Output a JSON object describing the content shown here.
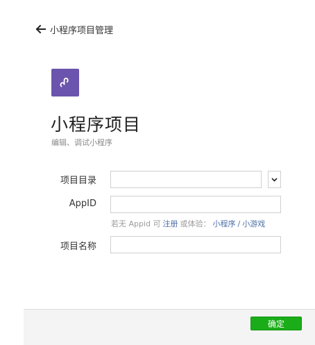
{
  "nav": {
    "back_label": "小程序项目管理"
  },
  "header": {
    "logo_icon": "mini-program-logo-icon",
    "logo_color": "#6b54ad",
    "title": "小程序项目",
    "subtitle": "编辑、调试小程序"
  },
  "form": {
    "directory": {
      "label": "项目目录",
      "value": ""
    },
    "appid": {
      "label": "AppID",
      "value": ""
    },
    "name": {
      "label": "项目名称",
      "value": ""
    },
    "hint": {
      "prefix": "若无 Appid 可",
      "register": "注册",
      "or_try": "或体验：",
      "mini_program": "小程序",
      "separator": "/",
      "mini_game": "小游戏"
    }
  },
  "footer": {
    "confirm_label": "确定",
    "accent": "#1aad19"
  }
}
